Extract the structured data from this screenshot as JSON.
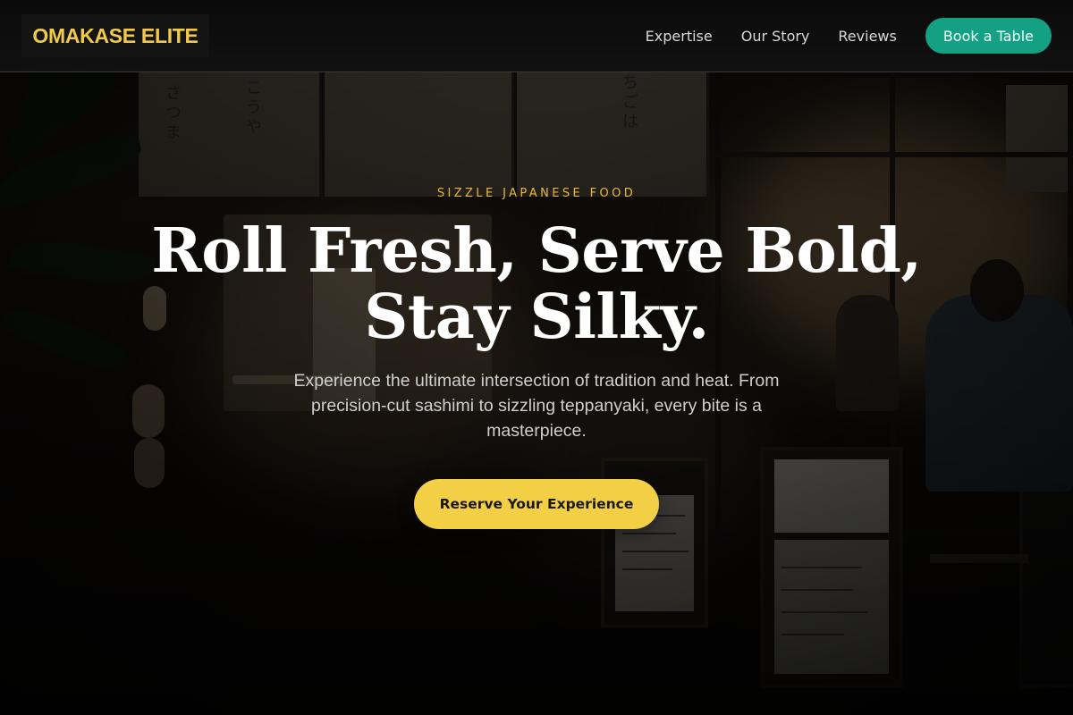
{
  "nav": {
    "brand": "OMAKASE ELITE",
    "links": [
      "Expertise",
      "Our Story",
      "Reviews"
    ],
    "cta_label": "Book a Table"
  },
  "hero": {
    "eyebrow": "SIZZLE JAPANESE FOOD",
    "headline_line1": "Roll Fresh, Serve Bold,",
    "headline_line2": "Stay Silky.",
    "subtitle": "Experience the ultimate intersection of tradition and heat. From precision-cut sashimi to sizzling teppanyaki, every bite is a masterpiece.",
    "cta_label": "Reserve Your Experience",
    "background": "izakaya-storefront-night-photo"
  },
  "colors": {
    "brand": "#f0c94d",
    "eyebrow": "#e8b83a",
    "book_button": "#14a082",
    "cta_button": "#f3cf45"
  }
}
